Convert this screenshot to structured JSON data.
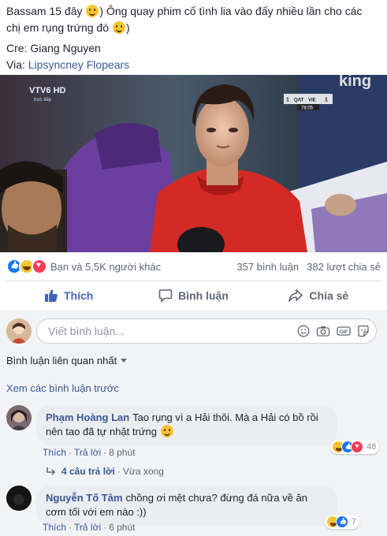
{
  "post": {
    "line1_a": "Bassam 15 đây",
    "line1_b": ") Ông quay phim cố tình lia vào đấy nhiều lần cho các",
    "line2": "chị em rụng trứng đó",
    "line2_end": ")",
    "credit_label": "Cre:",
    "credit_name": "Giang Nguyen",
    "via_label": "Via:",
    "via_name": "Lipsyncney Flopears"
  },
  "video": {
    "channel": "VTV6 HD",
    "live_label": "trực tiếp",
    "watermark": "king",
    "score_home": "QAT",
    "score_away": "VIE",
    "score_home_value": "1",
    "score_away_value": "1",
    "clock": "78:05"
  },
  "stats": {
    "reactions_text": "Bạn và 5,5K người khác",
    "comments": "357 bình luận",
    "shares": "382 lượt chia sẻ"
  },
  "actions": {
    "like": "Thích",
    "comment": "Bình luận",
    "share": "Chia sẻ"
  },
  "composer": {
    "placeholder": "Viết bình luận..."
  },
  "filter": {
    "relevance": "Bình luận liên quan nhất",
    "previous": "Xem các bình luận trước"
  },
  "comments": [
    {
      "name": "Phạm Hoàng Lan",
      "text": "Tao rụng vì a Hải thôi. Mà a Hải có bồ rồi nên tao đã tự nhặt trứng",
      "like": "Thích",
      "reply": "Trả lời",
      "time": "8 phút",
      "reactions": "48"
    },
    {
      "name": "Nguyễn Tố Tâm",
      "text": "chồng ơi mệt chưa? đừng đá nữa về ăn cơm tối với em nào :))",
      "like": "Thích",
      "reply": "Trả lời",
      "time": "6 phút",
      "reactions": "7"
    }
  ],
  "replies": {
    "count_text": "4 câu trả lời",
    "time": "Vừa xong"
  },
  "colors": {
    "link": "#385898",
    "like_active": "#4267b2",
    "comments_bg": "#f2f3f5"
  }
}
